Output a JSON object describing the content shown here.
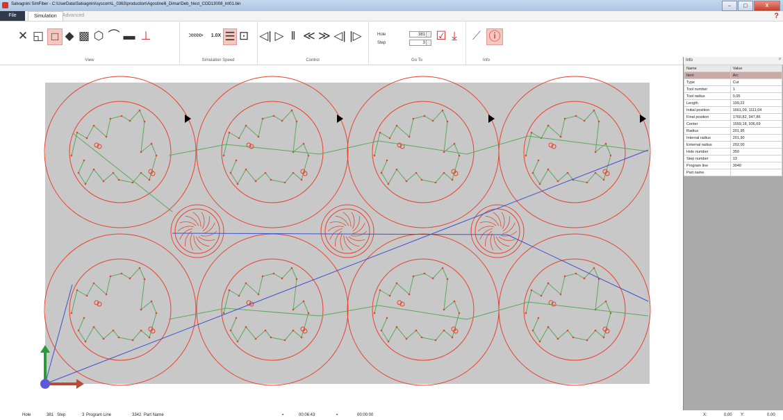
{
  "window": {
    "title": "Salvagnini SimFiber - C:\\UserData\\Salvagnini\\syscom\\L_0363\\production\\Agostinelli_Dimar\\Deb_Nest_COD13008_int01.bin",
    "minimize": "–",
    "maximize": "▢",
    "close": "X"
  },
  "menu": {
    "file": "File",
    "simulation": "Simulation",
    "advanced": "Advanced",
    "help": "?"
  },
  "ribbon": {
    "view_label": "View",
    "speed_label": "Simulation Speed",
    "speed_value": "1.0X",
    "control_label": "Control",
    "goto_label": "Go To",
    "hole_label": "Hole",
    "hole_value": "381",
    "step_label": "Step",
    "step_value": "3",
    "info_label": "Info"
  },
  "info": {
    "title": "Info",
    "col_name": "Name",
    "col_value": "Value",
    "rows": [
      {
        "name": "Item",
        "value": "Arc"
      },
      {
        "name": "Type",
        "value": "Cut"
      },
      {
        "name": "Tool number",
        "value": "1"
      },
      {
        "name": "Tool radius",
        "value": "0,05"
      },
      {
        "name": "Length",
        "value": "199,22"
      },
      {
        "name": "Initial position",
        "value": "1661,09, 1111,04"
      },
      {
        "name": "Final position",
        "value": "1760,82, 947,86"
      },
      {
        "name": "Center",
        "value": "1559,18, 936,69"
      },
      {
        "name": "Radius",
        "value": "201,95"
      },
      {
        "name": "Internal radius",
        "value": "201,90"
      },
      {
        "name": "External radius",
        "value": "202,00"
      },
      {
        "name": "Hole number",
        "value": "350"
      },
      {
        "name": "Step number",
        "value": "13"
      },
      {
        "name": "Program line",
        "value": "3040"
      },
      {
        "name": "Part name",
        "value": ""
      }
    ]
  },
  "status": {
    "hole_label": "Hole",
    "hole_value": "381",
    "step_label": "Step",
    "step_value": "3",
    "program_line_label": "Program Line",
    "program_line_value": "3342",
    "part_name_label": "Part Name",
    "time_elapsed": "00:06:43",
    "time_remaining": "00:00:00",
    "x_label": "X:",
    "x_value": "0.00",
    "y_label": "Y:",
    "y_value": "0.00"
  },
  "colors": {
    "cut_path": "#e8402a",
    "move_path": "#5aa85a",
    "rapid_path": "#3c4fd0",
    "sheet": "#c8c8c8"
  }
}
